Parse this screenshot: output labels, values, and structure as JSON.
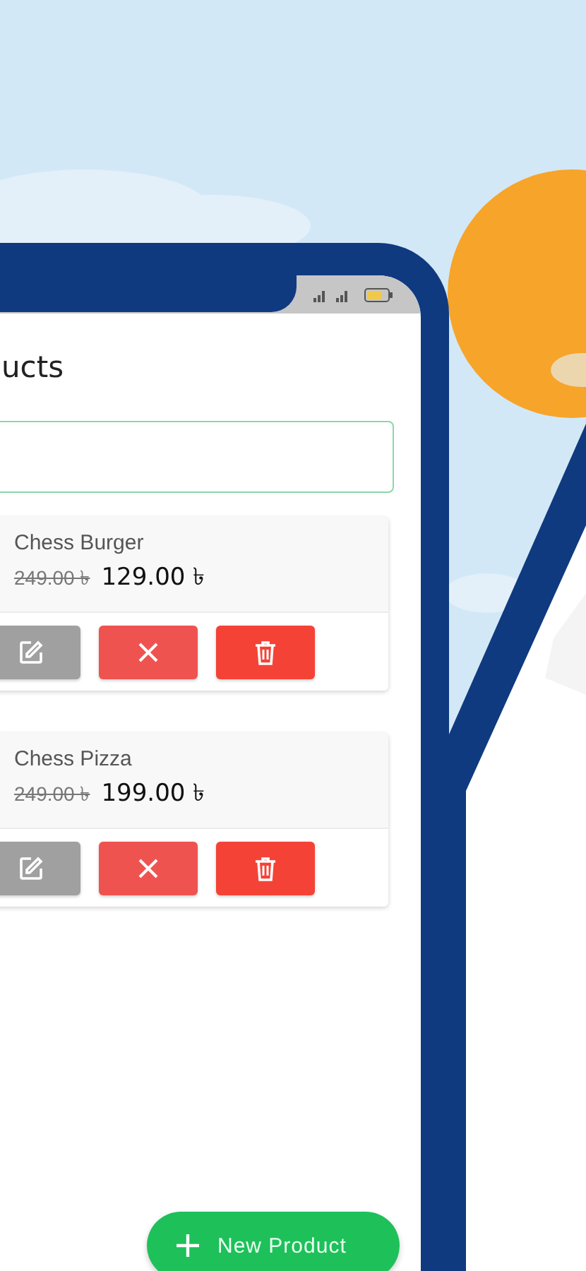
{
  "screen": {
    "title": "ucts"
  },
  "products": [
    {
      "name": "Chess Burger",
      "old_price": "249.00 ৳",
      "price": "129.00 ৳"
    },
    {
      "name": "Chess Pizza",
      "old_price": "249.00 ৳",
      "price": "199.00 ৳"
    }
  ],
  "fab": {
    "label": "New Product"
  }
}
